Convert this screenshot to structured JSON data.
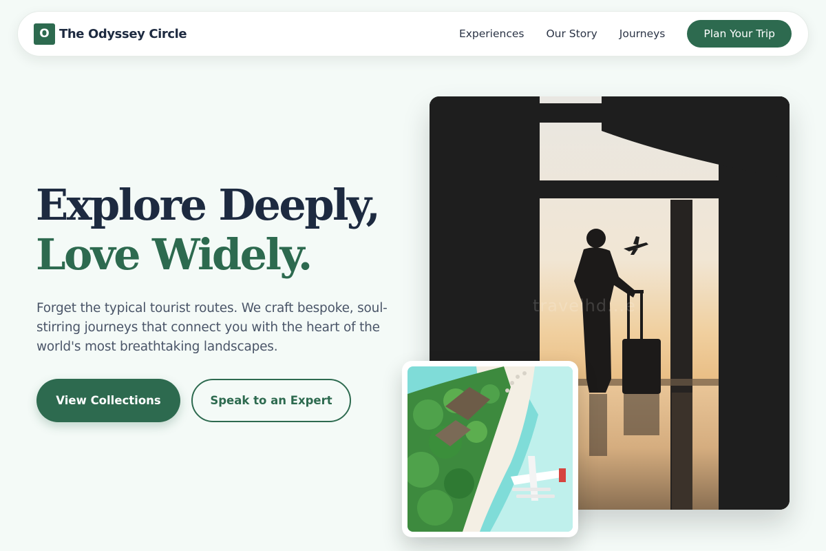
{
  "brand": {
    "mark": "O",
    "name": "The Odyssey Circle"
  },
  "nav": {
    "links": [
      "Experiences",
      "Our Story",
      "Journeys"
    ],
    "cta_label": "Plan Your Trip"
  },
  "hero": {
    "title_line1": "Explore Deeply,",
    "title_line2": "Love Widely.",
    "subtitle": "Forget the typical tourist routes. We craft bespoke, soul-stirring journeys that connect you with the heart of the world's most breathtaking landscapes.",
    "primary_button": "View Collections",
    "secondary_button": "Speak to an Expert"
  },
  "images": {
    "main_watermark": "travelhd...e",
    "main_description_icon": "traveler-silhouette-image",
    "inset_description_icon": "tropical-beach-seaplane-image"
  },
  "colors": {
    "accent": "#2d6a4f",
    "heading": "#1d2a40",
    "body_text": "#4a5568",
    "page_background": "#f4faf7"
  }
}
